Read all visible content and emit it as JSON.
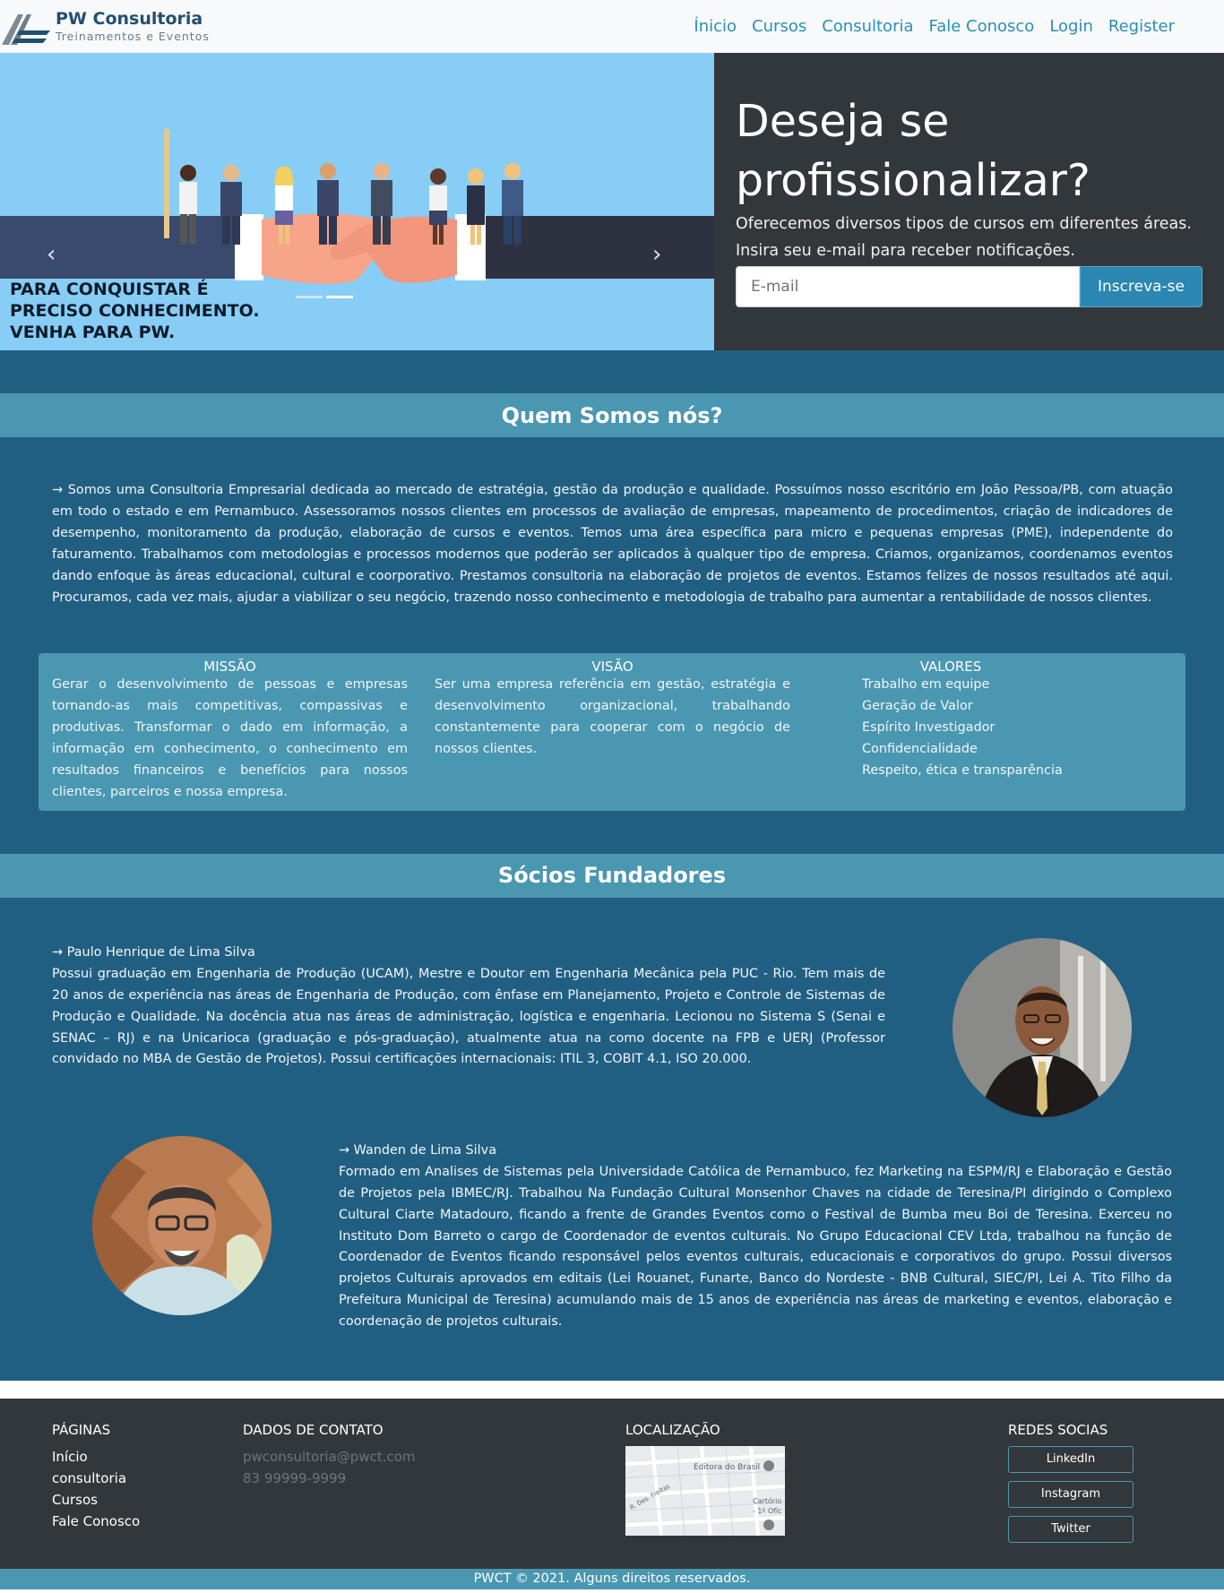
{
  "brand": {
    "title": "PW Consultoria",
    "subtitle": "Treinamentos e Eventos"
  },
  "nav": {
    "items": [
      "Ínicio",
      "Cursos",
      "Consultoria",
      "Fale Conosco",
      "Login",
      "Register"
    ]
  },
  "carousel": {
    "caption_lines": [
      "PARA CONQUISTAR É",
      "PRECISO CONHECIMENTO.",
      "VENHA PARA PW."
    ],
    "prev_icon": "chevron-left-icon",
    "next_icon": "chevron-right-icon",
    "active_slide": 2,
    "slide_count": 2
  },
  "signup": {
    "heading": "Deseja se profissionalizar?",
    "line1": "Oferecemos diversos tipos de cursos em diferentes áreas.",
    "line2": "Insira seu e-mail para receber notificações.",
    "email_placeholder": "E-mail",
    "button_label": "Inscreva-se"
  },
  "about": {
    "title": "Quem Somos nós?",
    "text": "→ Somos uma Consultoria Empresarial dedicada ao mercado de estratégia, gestão da produção e qualidade. Possuímos nosso escritório em João Pessoa/PB, com atuação em todo o estado e em Pernambuco. Assessoramos nossos clientes em processos de avaliação de empresas, mapeamento de procedimentos, criação de indicadores de desempenho, monitoramento da produção, elaboração de cursos e eventos. Temos uma área específica para micro e pequenas empresas (PME), independente do faturamento. Trabalhamos com metodologias e processos modernos que poderão ser aplicados à qualquer tipo de empresa. Criamos, organizamos, coordenamos eventos dando enfoque às áreas educacional, cultural e coorporativo. Prestamos consultoria na elaboração de projetos de eventos. Estamos felizes de nossos resultados até aqui. Procuramos, cada vez mais, ajudar a viabilizar o seu negócio, trazendo nosso conhecimento e metodologia de trabalho para aumentar a rentabilidade de nossos clientes."
  },
  "mission": {
    "title": "MISSÃO",
    "text": " Gerar o desenvolvimento de pessoas e empresas tornando-as mais competitivas, compassivas e produtivas. Transformar o dado em informação, a informação em conhecimento, o conhecimento em resultados financeiros e benefícios para nossos clientes, parceiros e nossa empresa."
  },
  "vision": {
    "title": "VISÃO",
    "text": " Ser uma empresa referência em gestão, estratégia e desenvolvimento organizacional, trabalhando constantemente para cooperar com o negócio de nossos clientes."
  },
  "values": {
    "title": "VALORES",
    "items": [
      "Trabalho em equipe",
      "Geração de Valor",
      "Espírito Investigador",
      "Confidencialidade",
      "Respeito, ética e transparência"
    ]
  },
  "founders": {
    "title": "Sócios Fundadores",
    "people": [
      {
        "name": "→ Paulo Henrique de Lima Silva",
        "bio": " Possui graduação em Engenharia de Produção (UCAM), Mestre e Doutor em Engenharia Mecânica pela PUC - Rio. Tem mais de 20 anos de experiência nas áreas de Engenharia de Produção, com ênfase em Planejamento, Projeto e Controle de Sistemas de Produção e Qualidade. Na docência atua nas áreas de administração, logística e engenharia. Lecionou no Sistema S (Senai e SENAC – RJ) e na Unicarioca (graduação e pós-graduação), atualmente atua na como docente na FPB e UERJ (Professor convidado no MBA de Gestão de Projetos). Possui certificações internacionais: ITIL 3, COBIT 4.1, ISO 20.000."
      },
      {
        "name": "→ Wanden de Lima Silva",
        "bio": " Formado em Analises de Sistemas pela Universidade Católica de Pernambuco, fez Marketing na ESPM/RJ e Elaboração e Gestão de Projetos pela IBMEC/RJ. Trabalhou Na Fundação Cultural Monsenhor Chaves na cidade de Teresina/PI dirigindo o Complexo Cultural Ciarte Matadouro, ficando a frente de Grandes Eventos como o Festival de Bumba meu Boi de Teresina. Exerceu no Instituto Dom Barreto o cargo de Coordenador de eventos culturais. No Grupo Educacional CEV Ltda, trabalhou na função de Coordenador de Eventos ficando responsável pelos eventos culturais, educacionais e corporativos do grupo. Possui diversos projetos Culturais aprovados em editais (Lei Rouanet, Funarte, Banco do Nordeste - BNB Cultural, SIEC/PI, Lei A. Tito Filho da Prefeitura Municipal de Teresina) acumulando mais de 15 anos de experiência nas áreas de marketing e eventos, elaboração e coordenação de projetos culturais."
      }
    ]
  },
  "footer": {
    "pages_title": "PÁGINAS",
    "pages": [
      "Início",
      "consultoria",
      "Cursos",
      "Fale Conosco"
    ],
    "contact_title": "DADOS DE CONTATO",
    "email": "pwconsultoria@pwct.com",
    "phone": "83 99999-9999",
    "location_title": "LOCALIZAÇÃO",
    "map_labels": [
      "Editora do Brasil",
      "R. Des. Freitas",
      "Cartório",
      "- 1º Ofíc"
    ],
    "social_title": "REDES SOCIAS",
    "social": [
      "LinkedIn",
      "Instagram",
      "Twitter"
    ],
    "copyright": "PWCT © 2021. Alguns direitos reservados."
  },
  "colors": {
    "primary_dark": "#215f82",
    "accent": "#4a97b1",
    "nav_link": "#2a8fb5",
    "dark_panel": "#32373c"
  }
}
